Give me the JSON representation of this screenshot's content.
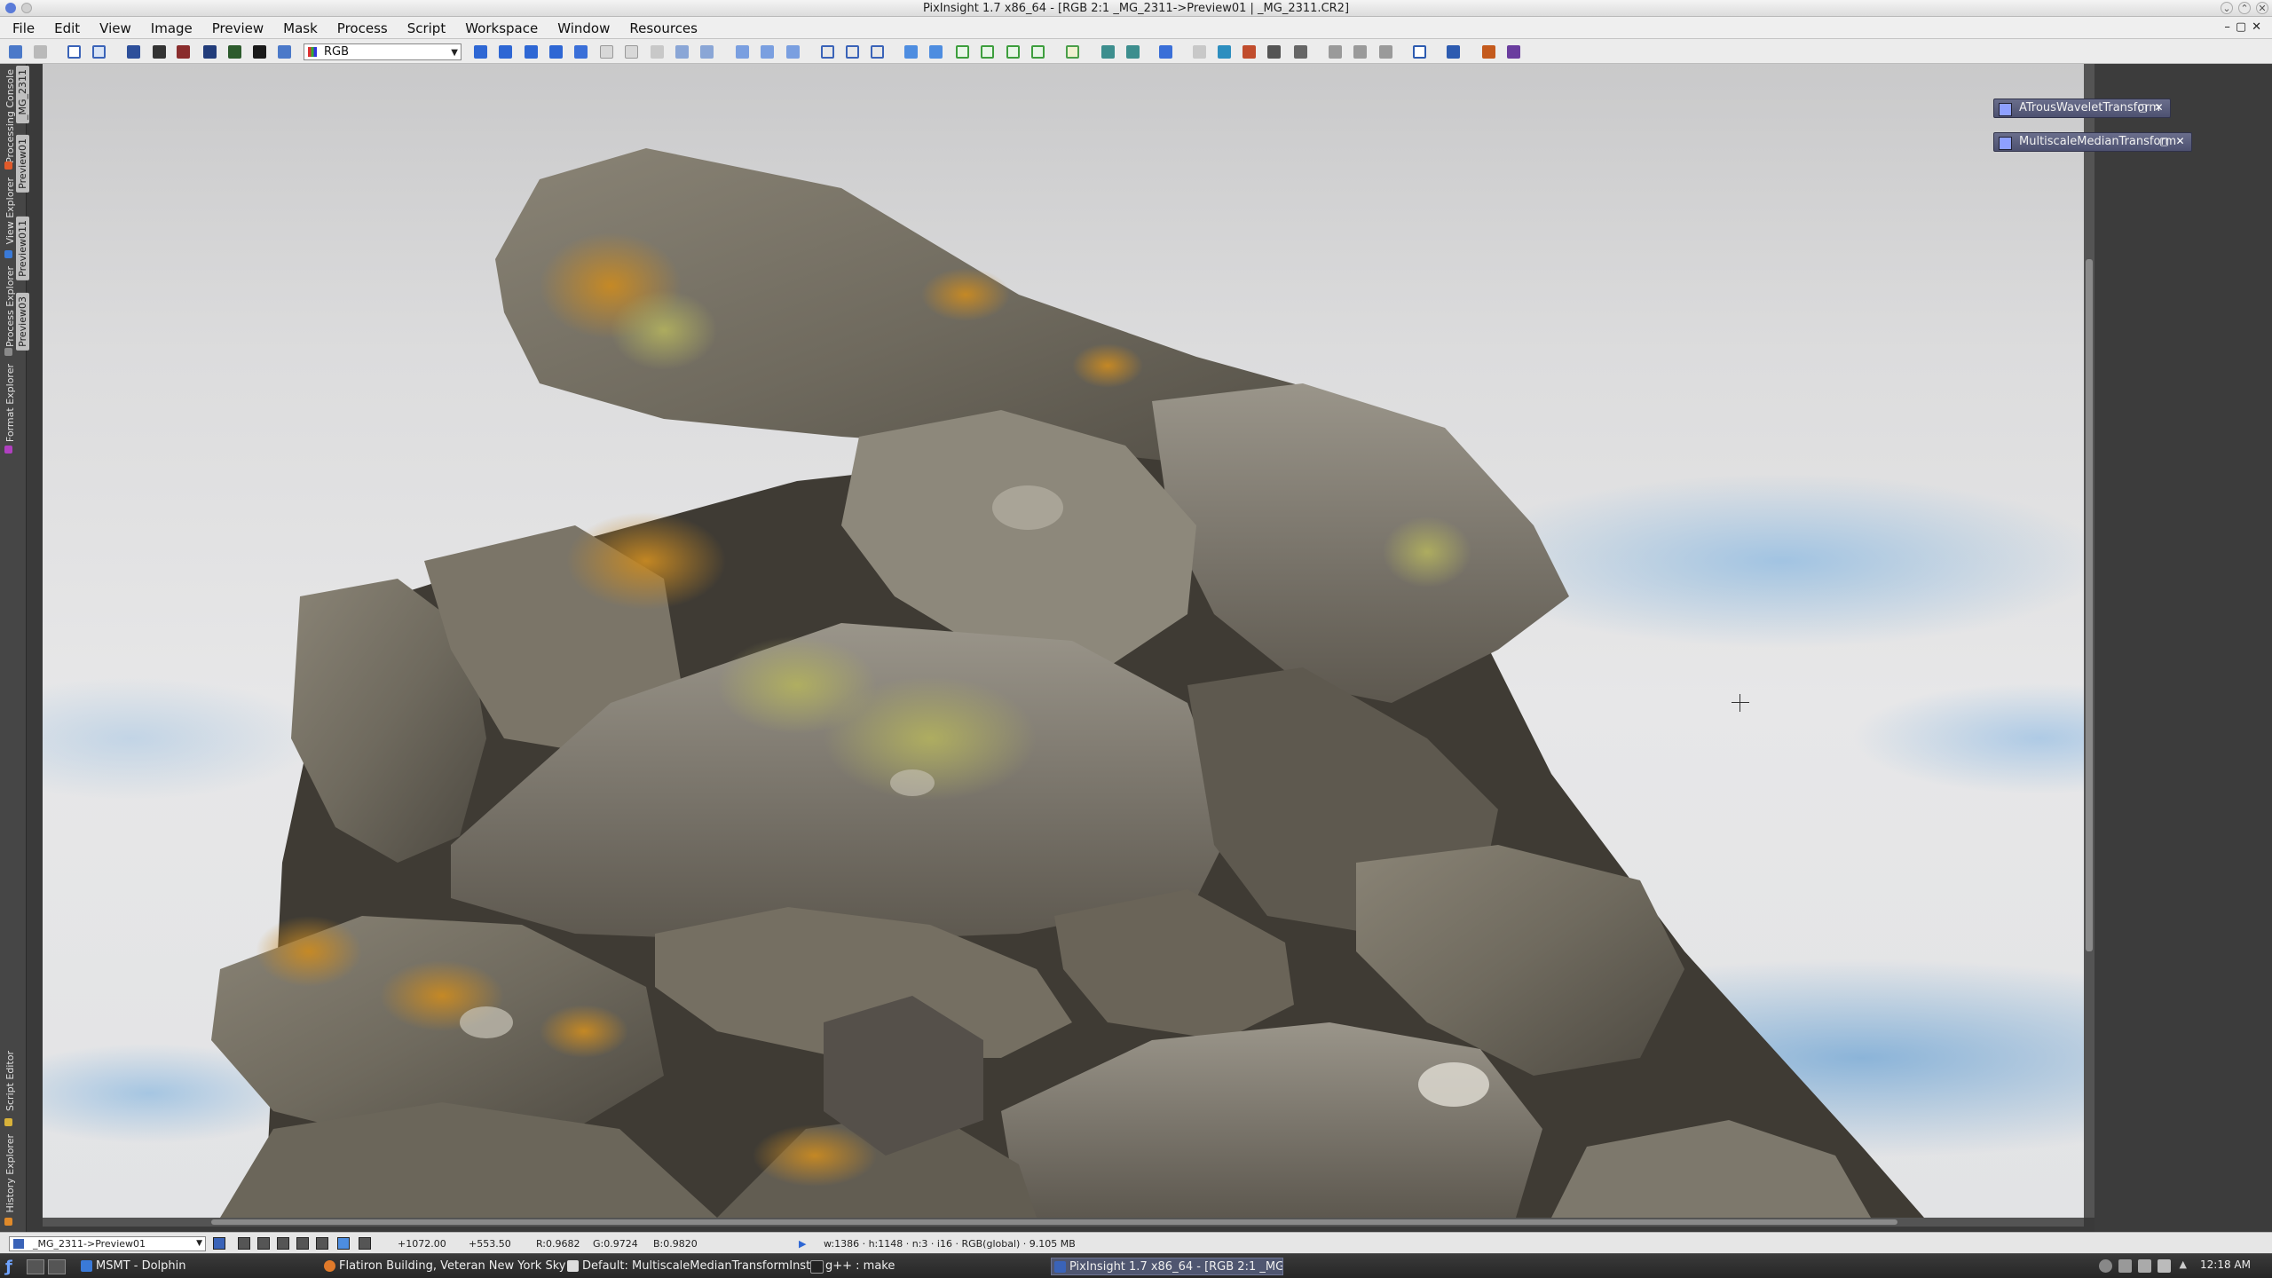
{
  "window": {
    "title": "PixInsight 1.7 x86_64 - [RGB 2:1 _MG_2311->Preview01 | _MG_2311.CR2]"
  },
  "menubar": {
    "items": [
      "File",
      "Edit",
      "View",
      "Image",
      "Preview",
      "Mask",
      "Process",
      "Script",
      "Workspace",
      "Window",
      "Resources"
    ]
  },
  "toolbar": {
    "channel_combo": "RGB"
  },
  "left_panel": {
    "tabs": [
      "Processing Console",
      "View Explorer",
      "Process Explorer",
      "Format Explorer",
      "Script Editor",
      "History Explorer"
    ],
    "iconized_views": [
      "_MG_2311",
      "Preview01",
      "Preview011",
      "Preview03"
    ]
  },
  "process_icons": [
    {
      "label": "ATrousWaveletTransform"
    },
    {
      "label": "MultiscaleMedianTransform"
    }
  ],
  "statusbar": {
    "view_selector": "_MG_2311->Preview01",
    "x": "+1072.00",
    "y": "+553.50",
    "r": "R:0.9682",
    "g": "G:0.9724",
    "b": "B:0.9820",
    "geometry": "w:1386 · h:1148 · n:3 · i16 · RGB(global) · 9.105 MB"
  },
  "taskbar": {
    "tasks": [
      {
        "label": "MSMT - Dolphin",
        "active": false
      },
      {
        "label": "Flatiron Building, Veteran New York Sky",
        "active": false
      },
      {
        "label": "Default: MultiscaleMedianTransformInst",
        "active": false
      },
      {
        "label": "g++ : make",
        "active": false
      },
      {
        "label": "PixInsight 1.7 x86_64 - [RGB 2:1 _MG_2",
        "active": true
      }
    ],
    "clock": "12:18 AM"
  },
  "colors": {
    "sky_blue": "#9cc3e3",
    "rock_grey": "#7b7466",
    "lichen_orange": "#c08a2a",
    "lichen_green": "#a6a45a",
    "process_icon_bg": "#5a5e7e"
  }
}
